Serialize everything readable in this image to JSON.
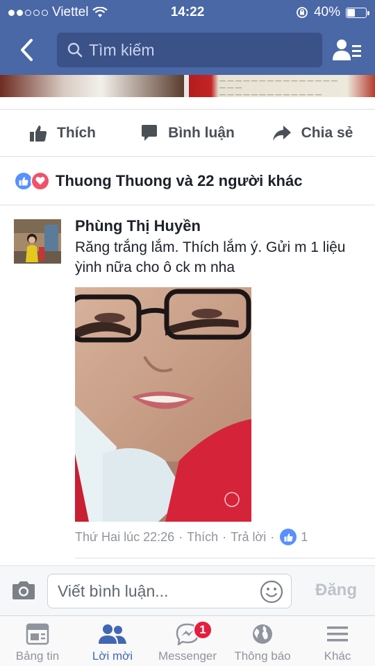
{
  "status_bar": {
    "carrier": "Viettel",
    "time": "14:22",
    "battery": "40%",
    "battery_level": 0.4
  },
  "nav": {
    "search_placeholder": "Tìm kiếm"
  },
  "post": {
    "actions": [
      {
        "label": "Thích",
        "icon": "thumbs-up-icon"
      },
      {
        "label": "Bình luận",
        "icon": "comment-icon"
      },
      {
        "label": "Chia sẻ",
        "icon": "share-arrow-icon"
      }
    ],
    "reactions_text": "Thuong Thuong và 22 người khác"
  },
  "comment": {
    "author": "Phùng Thị Huyền",
    "text": "Răng trắng lắm. Thích lắm ý. Gửi m 1 liệu ỳinh nữa cho ô ck m nha",
    "timestamp": "Thứ Hai lúc 22:26",
    "like_label": "Thích",
    "reply_label": "Trả lời",
    "like_count": "1"
  },
  "composer": {
    "placeholder": "Viết bình luận...",
    "post_label": "Đăng"
  },
  "tabbar": {
    "tabs": [
      {
        "label": "Bảng tin",
        "icon": "news-feed-icon"
      },
      {
        "label": "Lời mời",
        "icon": "friend-requests-icon",
        "active": true
      },
      {
        "label": "Messenger",
        "icon": "messenger-icon",
        "badge": "1"
      },
      {
        "label": "Thông báo",
        "icon": "globe-icon"
      },
      {
        "label": "Khác",
        "icon": "menu-icon"
      }
    ]
  },
  "colors": {
    "header": "#4a67a6",
    "accent": "#4267b2",
    "like_blue": "#5890ff",
    "love_red": "#f25268",
    "badge_red": "#e41e3f"
  }
}
